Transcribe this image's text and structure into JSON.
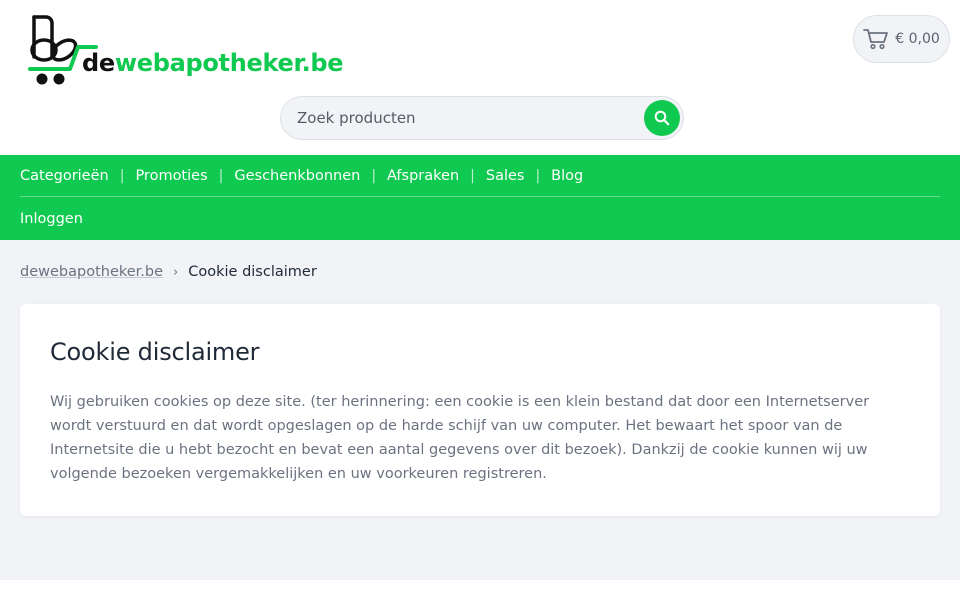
{
  "header": {
    "logo": {
      "prefix": "de",
      "rest": "webapotheker.be"
    },
    "cart": {
      "amount": "€ 0,00",
      "icon": "cart-icon"
    },
    "search": {
      "placeholder": "Zoek producten",
      "icon": "search-icon"
    }
  },
  "nav": {
    "items": [
      "Categorieën",
      "Promoties",
      "Geschenkbonnen",
      "Afspraken",
      "Sales",
      "Blog"
    ],
    "login": "Inloggen"
  },
  "breadcrumb": {
    "home": "dewebapotheker.be",
    "current": "Cookie disclaimer"
  },
  "content": {
    "title": "Cookie disclaimer",
    "body": "Wij gebruiken cookies op deze site. (ter herinnering: een cookie is een klein bestand dat door een Internetserver wordt verstuurd en dat wordt opgeslagen op de harde schijf van uw computer. Het bewaart het spoor van de Internetsite die u hebt bezocht en bevat een aantal gegevens over dit bezoek). Dankzij de cookie kunnen wij uw volgende bezoeken vergemakkelijken en uw voorkeuren registreren."
  },
  "colors": {
    "brand": "#10c950",
    "background": "#f1f3f6",
    "text": "#1f2937",
    "muted": "#6b7280"
  }
}
